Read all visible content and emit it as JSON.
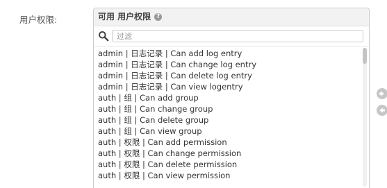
{
  "field": {
    "label": "用户权限:"
  },
  "selector": {
    "title": "可用 用户权限",
    "help_icon": "help-icon",
    "filter": {
      "placeholder": "过滤",
      "value": ""
    },
    "options": [
      "admin | 日志记录 | Can add log entry",
      "admin | 日志记录 | Can change log entry",
      "admin | 日志记录 | Can delete log entry",
      "admin | 日志记录 | Can view logentry",
      "auth | 组 | Can add group",
      "auth | 组 | Can change group",
      "auth | 组 | Can delete group",
      "auth | 组 | Can view group",
      "auth | 权限 | Can add permission",
      "auth | 权限 | Can change permission",
      "auth | 权限 | Can delete permission",
      "auth | 权限 | Can view permission"
    ]
  },
  "controls": {
    "add_icon": "arrow-right-icon",
    "remove_icon": "arrow-left-icon"
  },
  "colors": {
    "button_bg": "#c6c6c6",
    "title_bg": "#f2f2f2",
    "border": "#cccccc"
  }
}
